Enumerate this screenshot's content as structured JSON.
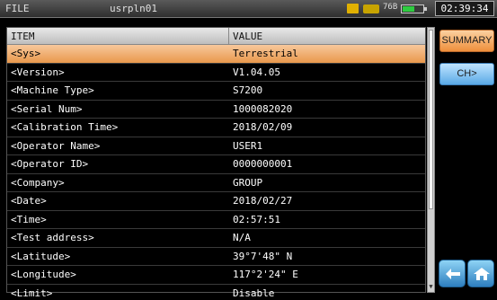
{
  "topbar": {
    "menu_label": "FILE",
    "file_name": "usrpln01",
    "status_icons": [
      "folder-icon",
      "usb-icon",
      "battery-icon"
    ],
    "battery_label": "76B",
    "battery_level": 0.55,
    "time": "02:39:34"
  },
  "table": {
    "headers": {
      "item": "ITEM",
      "value": "VALUE"
    },
    "rows": [
      {
        "item": "<Sys>",
        "value": "Terrestrial"
      },
      {
        "item": "<Version>",
        "value": "V1.04.05"
      },
      {
        "item": "<Machine Type>",
        "value": "S7200"
      },
      {
        "item": "<Serial Num>",
        "value": "1000082020"
      },
      {
        "item": "<Calibration Time>",
        "value": "2018/02/09"
      },
      {
        "item": "<Operator Name>",
        "value": "USER1"
      },
      {
        "item": "<Operator ID>",
        "value": "0000000001"
      },
      {
        "item": "<Company>",
        "value": "GROUP"
      },
      {
        "item": "<Date>",
        "value": "2018/02/27"
      },
      {
        "item": "<Time>",
        "value": "02:57:51"
      },
      {
        "item": "<Test address>",
        "value": "N/A"
      },
      {
        "item": "<Latitude>",
        "value": "39°7'48\" N"
      },
      {
        "item": "<Longitude>",
        "value": "117°2'24\" E"
      },
      {
        "item": "<Limit>",
        "value": "Disable"
      }
    ],
    "selected_index": 0
  },
  "side_buttons": {
    "summary_label": "SUMMARY",
    "ch_label": "CH>"
  },
  "nav_icons": [
    "back-arrow-icon",
    "home-icon"
  ],
  "colors": {
    "selection": "#ee9a52",
    "summary_button": "#f3a45a",
    "ch_button": "#6fb4ea",
    "nav_button": "#3a8fcf"
  }
}
